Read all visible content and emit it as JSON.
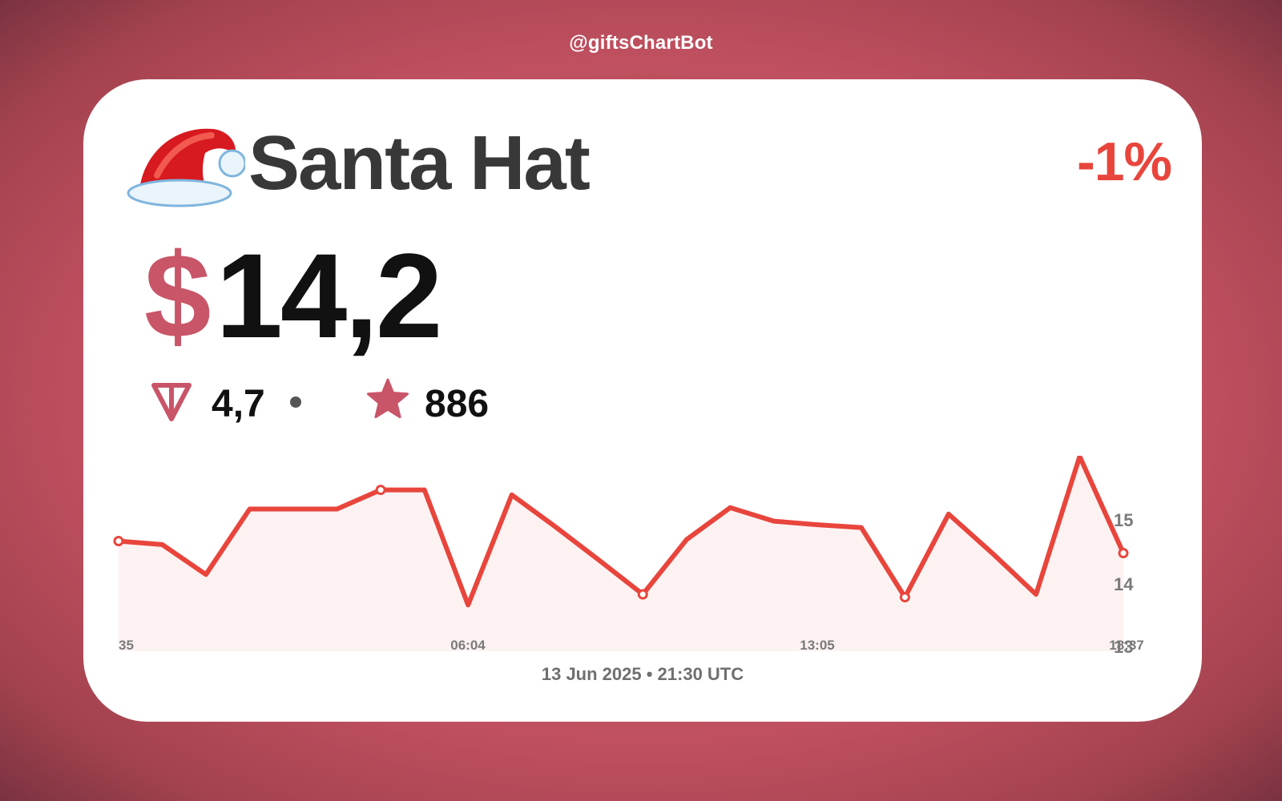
{
  "header": {
    "bot_handle": "@giftsChartBot"
  },
  "gift": {
    "name": "Santa Hat",
    "icon": "santa-hat-icon",
    "change_percent": "-1%",
    "price_currency": "$",
    "price_usd": "14,2",
    "price_ton": "4,7",
    "price_stars": "886"
  },
  "colors": {
    "accent": "#e8453c",
    "brand": "#c95569",
    "background": "#b14d55",
    "fill": "#fdf2f2"
  },
  "chart_data": {
    "type": "area",
    "x_tick_labels": [
      "35",
      "06:04",
      "13:05",
      "18:37"
    ],
    "y_tick_labels": [
      "15",
      "14",
      "13"
    ],
    "ylim": [
      12.9,
      15.65
    ],
    "values": [
      14.45,
      14.4,
      13.98,
      14.9,
      14.9,
      14.9,
      15.17,
      15.17,
      13.55,
      15.1,
      14.65,
      14.18,
      13.7,
      14.47,
      14.92,
      14.73,
      14.68,
      14.64,
      13.66,
      14.83,
      14.28,
      13.7,
      15.64,
      14.28
    ],
    "highlight_indices": [
      0,
      6,
      12,
      18,
      23
    ],
    "grid": false,
    "legend": "none"
  },
  "footer": {
    "timestamp": "13 Jun 2025 • 21:30 UTC"
  }
}
